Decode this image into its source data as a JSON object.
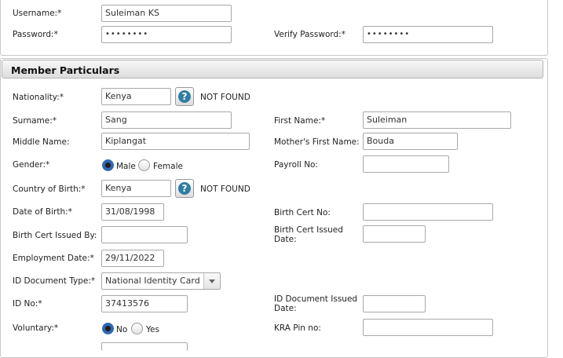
{
  "account": {
    "username_label": "Username:*",
    "username_value": "Suleiman KS",
    "password_label": "Password:*",
    "password_value": "••••••••",
    "verify_password_label": "Verify Password:*",
    "verify_password_value": "••••••••"
  },
  "member": {
    "section_title": "Member Particulars",
    "nationality_label": "Nationality:*",
    "nationality_value": "Kenya",
    "nationality_status": "NOT FOUND",
    "surname_label": "Surname:*",
    "surname_value": "Sang",
    "first_name_label": "First Name:*",
    "first_name_value": "Suleiman",
    "middle_name_label": "Middle Name:",
    "middle_name_value": "Kiplangat",
    "mothers_first_name_label": "Mother's First Name:",
    "mothers_first_name_value": "Bouda",
    "gender_label": "Gender:*",
    "gender_male_label": "Male",
    "gender_female_label": "Female",
    "payroll_no_label": "Payroll No:",
    "payroll_no_value": "",
    "country_of_birth_label": "Country of Birth:*",
    "country_of_birth_value": "Kenya",
    "country_of_birth_status": "NOT FOUND",
    "dob_label": "Date of Birth:*",
    "dob_value": "31/08/1998",
    "birth_cert_no_label": "Birth Cert No:",
    "birth_cert_no_value": "",
    "birth_cert_issued_by_label": "Birth Cert Issued By:",
    "birth_cert_issued_by_value": "",
    "birth_cert_issued_date_label": "Birth Cert Issued Date:",
    "birth_cert_issued_date_value": "",
    "employment_date_label": "Employment Date:*",
    "employment_date_value": "29/11/2022",
    "id_doc_type_label": "ID Document Type:*",
    "id_doc_type_value": "National Identity Card",
    "id_no_label": "ID No:*",
    "id_no_value": "37413576",
    "id_doc_issued_date_label": "ID Document Issued Date:",
    "id_doc_issued_date_value": "",
    "voluntary_label": "Voluntary:*",
    "voluntary_no_label": "No",
    "voluntary_yes_label": "Yes",
    "kra_pin_label": "KRA Pin no:",
    "kra_pin_value": ""
  },
  "icons": {
    "help": "?"
  },
  "colors": {
    "help_icon": "#2f7ea3",
    "radio_selected": "#2f66b3"
  }
}
